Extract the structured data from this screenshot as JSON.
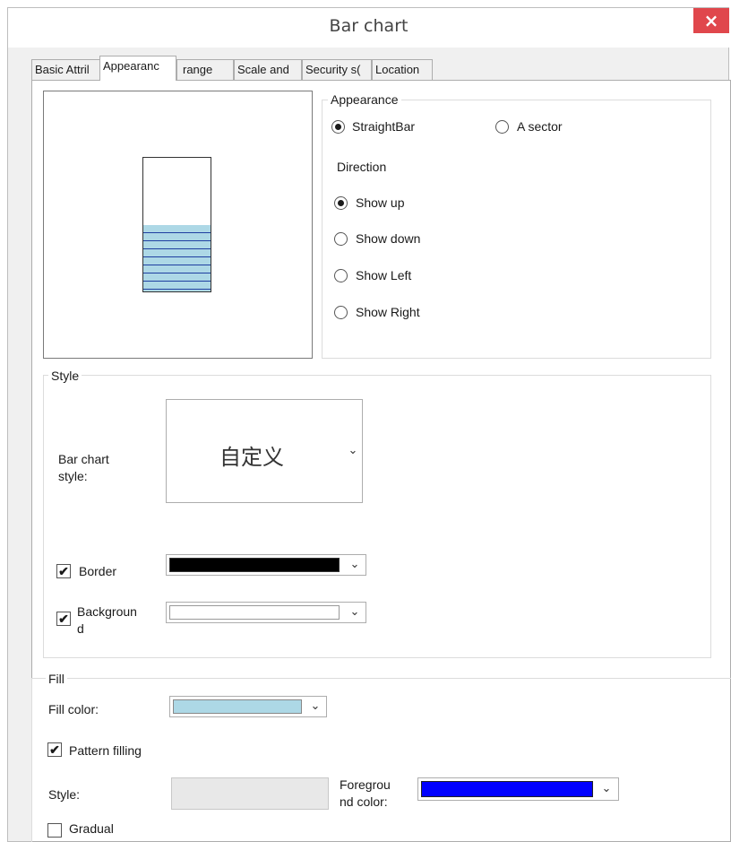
{
  "window": {
    "title": "Bar chart",
    "close_glyph": "×"
  },
  "tabs": [
    {
      "label": "Basic Attril",
      "active": false
    },
    {
      "label": "Appearanc",
      "active": true
    },
    {
      "label": "range",
      "active": false
    },
    {
      "label": "Scale and",
      "active": false
    },
    {
      "label": "Security s(",
      "active": false
    },
    {
      "label": "Location",
      "active": false
    }
  ],
  "preview": {
    "fill_level": 0.5,
    "fill_color": "#add8e6",
    "pattern_color": "#1f3fa0"
  },
  "appearance": {
    "label": "Appearance",
    "straight_bar_label": "StraightBar",
    "sector_label": "A sector",
    "selected": "StraightBar",
    "direction_label": "Direction",
    "directions": [
      {
        "label": "Show up",
        "checked": true
      },
      {
        "label": "Show down",
        "checked": false
      },
      {
        "label": "Show Left",
        "checked": false
      },
      {
        "label": "Show Right",
        "checked": false
      }
    ]
  },
  "style": {
    "label": "Style",
    "bar_chart_style_label_1": "Bar chart",
    "bar_chart_style_label_2": "style:",
    "bar_chart_style_value": "自定义",
    "border_label": "Border",
    "border_checked": true,
    "border_color": "#000000",
    "background_label_1": "Backgroun",
    "background_label_2": "d",
    "background_checked": true,
    "background_color": "#ffffff"
  },
  "fill": {
    "label": "Fill",
    "fill_color_label": "Fill color:",
    "fill_color": "#add8e6",
    "pattern_filling_label": "Pattern filling",
    "pattern_filling_checked": true,
    "style_label": "Style:",
    "foreground_label_1": "Foregrou",
    "foreground_label_2": "nd color:",
    "foreground_color": "#0000ff",
    "gradual_label": "Gradual",
    "gradual_checked": false
  },
  "icons": {
    "check_glyph": "✔",
    "chevron_glyph": "⌄"
  }
}
